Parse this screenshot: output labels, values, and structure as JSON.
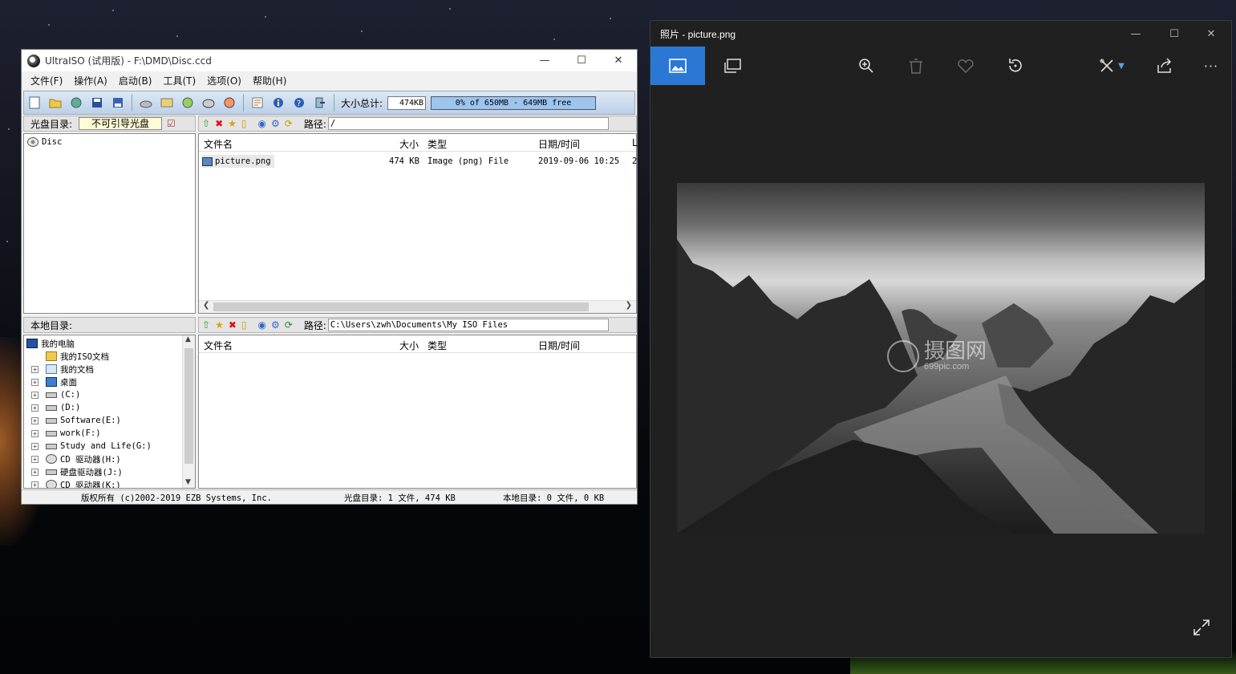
{
  "ultraiso": {
    "title": "UltraISO (试用版) - F:\\DMD\\Disc.ccd",
    "menu": [
      "文件(F)",
      "操作(A)",
      "启动(B)",
      "工具(T)",
      "选项(O)",
      "帮助(H)"
    ],
    "size_total_label": "大小总计:",
    "size_total_value": "474KB",
    "capacity_text": "0% of 650MB - 649MB free",
    "disc_dir_label": "光盘目录:",
    "boot_state": "不可引导光盘",
    "path_label": "路径:",
    "disc_path": "/",
    "disc_tree_root": "Disc",
    "disc_columns": [
      "文件名",
      "大小",
      "类型",
      "日期/时间",
      "L"
    ],
    "disc_files": [
      {
        "name": "picture.png",
        "size": "474 KB",
        "type": "Image (png) File",
        "date": "2019-09-06 10:25",
        "extra": "2"
      }
    ],
    "local_dir_label": "本地目录:",
    "local_path": "C:\\Users\\zwh\\Documents\\My ISO Files",
    "local_columns": [
      "文件名",
      "大小",
      "类型",
      "日期/时间"
    ],
    "local_tree": [
      {
        "label": "我的电脑",
        "indent": 0,
        "expander": ""
      },
      {
        "label": "我的ISO文档",
        "indent": 1,
        "expander": ""
      },
      {
        "label": "我的文档",
        "indent": 1,
        "expander": "+"
      },
      {
        "label": "桌面",
        "indent": 1,
        "expander": "+"
      },
      {
        "label": "(C:)",
        "indent": 1,
        "expander": "+"
      },
      {
        "label": "(D:)",
        "indent": 1,
        "expander": "+"
      },
      {
        "label": "Software(E:)",
        "indent": 1,
        "expander": "+"
      },
      {
        "label": "work(F:)",
        "indent": 1,
        "expander": "+"
      },
      {
        "label": "Study and Life(G:)",
        "indent": 1,
        "expander": "+"
      },
      {
        "label": "CD 驱动器(H:)",
        "indent": 1,
        "expander": "+"
      },
      {
        "label": "硬盘驱动器(J:)",
        "indent": 1,
        "expander": "+"
      },
      {
        "label": "CD 驱动器(K:)",
        "indent": 1,
        "expander": "+"
      }
    ],
    "status_copyright": "版权所有 (c)2002-2019 EZB Systems, Inc.",
    "status_disc": "光盘目录: 1 文件, 474 KB",
    "status_local": "本地目录: 0 文件, 0 KB"
  },
  "photos": {
    "title": "照片 - picture.png",
    "watermark_main": "摄图网",
    "watermark_sub": "699pic.com",
    "icons": [
      "image-icon",
      "slideshow-icon",
      "zoom-in-icon",
      "delete-icon",
      "favorite-icon",
      "rotate-icon",
      "edit-icon",
      "share-icon",
      "more-icon",
      "fullscreen-icon"
    ]
  }
}
